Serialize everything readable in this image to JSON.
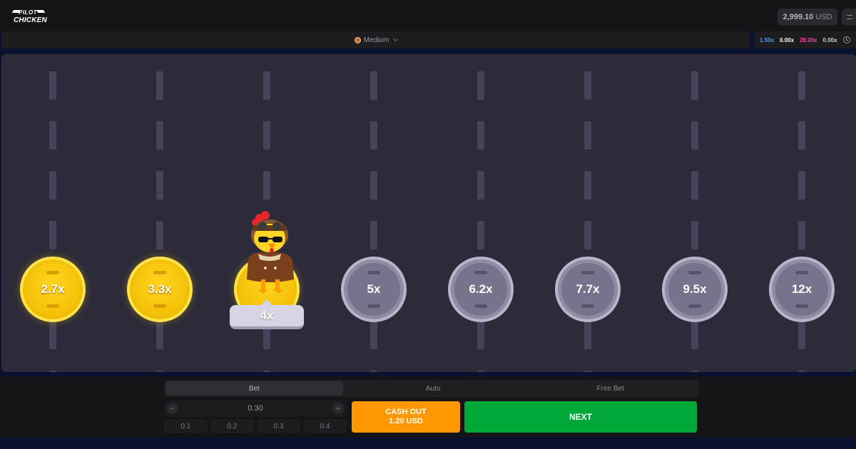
{
  "header": {
    "logo_top": "PILOT",
    "logo_bottom": "CHICKEN",
    "balance_amount": "2,999.10",
    "balance_currency": "USD"
  },
  "difficulty": {
    "label": "Medium"
  },
  "history": [
    {
      "value": "1.50x",
      "color": "#4a9dff"
    },
    {
      "value": "0.00x",
      "color": "#ffffff"
    },
    {
      "value": "28.00x",
      "color": "#ff3d9a"
    },
    {
      "value": "0.00x",
      "color": "#d0d0d0"
    }
  ],
  "lanes": [
    {
      "multiplier": "2.7x",
      "state": "collected"
    },
    {
      "multiplier": "3.3x",
      "state": "collected"
    },
    {
      "multiplier": "4x",
      "state": "current"
    },
    {
      "multiplier": "5x",
      "state": "locked"
    },
    {
      "multiplier": "6.2x",
      "state": "locked"
    },
    {
      "multiplier": "7.7x",
      "state": "locked"
    },
    {
      "multiplier": "9.5x",
      "state": "locked"
    },
    {
      "multiplier": "12x",
      "state": "locked"
    }
  ],
  "controls": {
    "tabs": [
      "Bet",
      "Auto",
      "Free Bet"
    ],
    "stake": "0.30",
    "minus": "−",
    "plus": "+",
    "quick_amounts": [
      "0.1",
      "0.2",
      "0.3",
      "0.4"
    ],
    "cashout_label": "CASH OUT",
    "cashout_amount": "1.20 USD",
    "next_label": "NEXT"
  }
}
